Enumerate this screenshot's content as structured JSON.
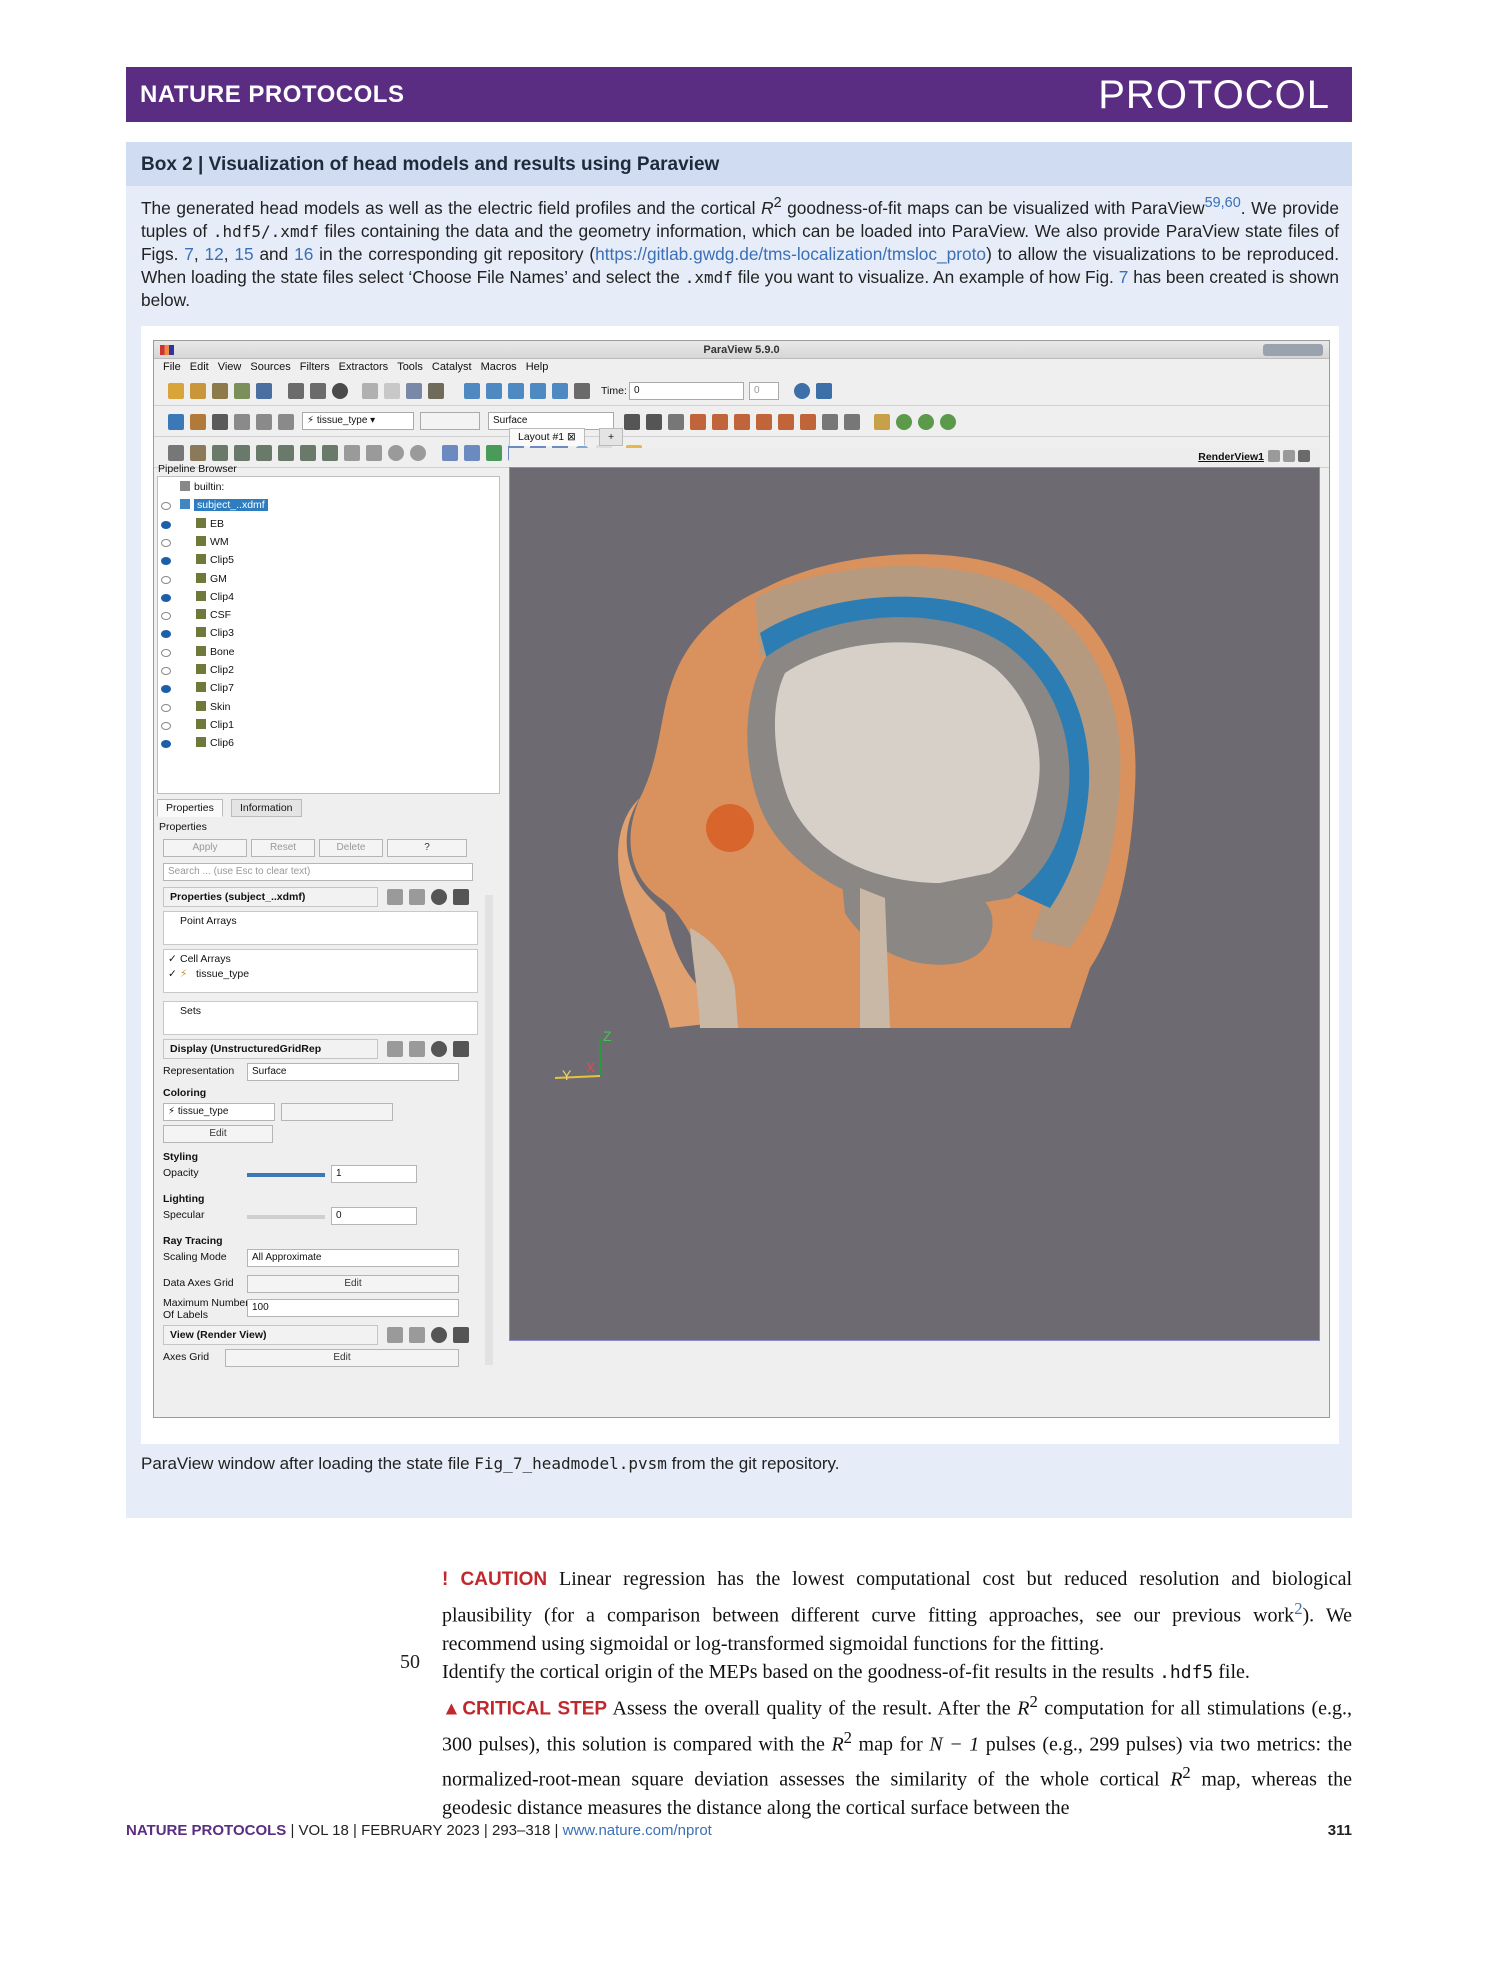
{
  "header": {
    "journal": "NATURE PROTOCOLS",
    "type": "PROTOCOL"
  },
  "box": {
    "title": "Box 2 | Visualization of head models and results using Paraview",
    "text_parts": [
      "The generated head models as well as the electric field profiles and the cortical ",
      "R",
      "2",
      " goodness-of-fit maps can be visualized with ParaView",
      "59,60",
      ". We provide tuples of ",
      ".hdf5/.xmdf",
      " files containing the data and the geometry information, which can be loaded into ParaView. We also provide ParaView state files of Figs. ",
      "7",
      ", ",
      "12",
      ", ",
      "15",
      " and ",
      "16",
      " in the corresponding git repository (",
      "https://gitlab.gwdg.de/tms-localization/tmsloc_proto",
      ") to allow the visualizations to be reproduced. When loading the state files select ‘Choose File Names’ and select the ",
      ".xmdf",
      " file you want to visualize. An example of how Fig. ",
      "7",
      " has been created is shown below."
    ],
    "caption_pre": "ParaView window after loading the state file ",
    "caption_file": "Fig_7_headmodel.pvsm",
    "caption_post": " from the git repository."
  },
  "paraview": {
    "title": "ParaView 5.9.0",
    "menu": [
      "File",
      "Edit",
      "View",
      "Sources",
      "Filters",
      "Extractors",
      "Tools",
      "Catalyst",
      "Macros",
      "Help"
    ],
    "time_label": "Time:",
    "time_value": "0",
    "time_index": "0",
    "color_array": "tissue_type",
    "representation_combo": "Surface",
    "pipeline_title": "Pipeline Browser",
    "pipeline": [
      {
        "label": "builtin:",
        "eye": "none"
      },
      {
        "label": "subject_..xdmf",
        "eye": "off"
      },
      {
        "label": "EB",
        "eye": "on"
      },
      {
        "label": "WM",
        "eye": "off"
      },
      {
        "label": "Clip5",
        "eye": "on"
      },
      {
        "label": "GM",
        "eye": "off"
      },
      {
        "label": "Clip4",
        "eye": "on"
      },
      {
        "label": "CSF",
        "eye": "off"
      },
      {
        "label": "Clip3",
        "eye": "on"
      },
      {
        "label": "Bone",
        "eye": "off"
      },
      {
        "label": "Clip2",
        "eye": "off"
      },
      {
        "label": "Clip7",
        "eye": "on"
      },
      {
        "label": "Skin",
        "eye": "off"
      },
      {
        "label": "Clip1",
        "eye": "off"
      },
      {
        "label": "Clip6",
        "eye": "on"
      }
    ],
    "tabs": [
      "Properties",
      "Information"
    ],
    "properties_title": "Properties",
    "apply": "Apply",
    "reset": "Reset",
    "delete": "Delete",
    "help": "?",
    "search_placeholder": "Search ... (use Esc to clear text)",
    "section_properties": "Properties (subject_..xdmf)",
    "point_arrays": "Point Arrays",
    "cell_arrays": "Cell Arrays",
    "cell_array_item": "tissue_type",
    "sets": "Sets",
    "section_display": "Display (UnstructuredGridRep",
    "representation_label": "Representation",
    "representation_value": "Surface",
    "coloring_label": "Coloring",
    "coloring_value": "tissue_type",
    "edit_label": "Edit",
    "styling_label": "Styling",
    "opacity_label": "Opacity",
    "opacity_value": "1",
    "lighting_label": "Lighting",
    "specular_label": "Specular",
    "specular_value": "0",
    "raytracing_label": "Ray Tracing",
    "scaling_label": "Scaling Mode",
    "scaling_value": "All Approximate",
    "data_axes_grid": "Data Axes Grid",
    "max_labels_1": "Maximum Number",
    "max_labels_2": "Of Labels",
    "max_labels_value": "100",
    "section_view": "View (Render View)",
    "axes_grid": "Axes Grid",
    "layout_tab": "Layout #1",
    "layout_add": "+",
    "renderview": "RenderView1",
    "axis_z": "Z",
    "axis_y": "Y",
    "axis_x": "X"
  },
  "body": {
    "caution_label": "! CAUTION",
    "caution_text": " Linear regression has the lowest computational cost but reduced resolution and biological plausibility (for a comparison between different curve fitting approaches, see our previous work",
    "caution_ref": "2",
    "caution_end": "). We recommend using sigmoidal or log-transformed sigmoidal functions for the fitting.",
    "step_number": "50",
    "step_text_pre": "Identify the cortical origin of the MEPs based on the goodness-of-fit results in the results ",
    "step_file": ".hdf5",
    "step_text_post": " file.",
    "critical_label": "▲CRITICAL STEP",
    "critical_text_1": " Assess the overall quality of the result. After the ",
    "critical_text_2": " computation for all stimulations (e.g., 300 pulses), this solution is compared with the ",
    "critical_text_3": " map for ",
    "critical_text_4": " pulses (e.g., 299 pulses) via two metrics: the normalized-root-mean square deviation assesses the similarity of the whole cortical ",
    "critical_text_5": " map, whereas the geodesic distance measures the distance along the cortical surface between the",
    "r2_r": "R",
    "r2_sup": "2",
    "n_minus": "N − 1"
  },
  "footer": {
    "journal": "NATURE PROTOCOLS",
    "meta": " | VOL 18 | FEBRUARY 2023 | 293–318 | ",
    "url": "www.nature.com/nprot",
    "page": "311"
  }
}
